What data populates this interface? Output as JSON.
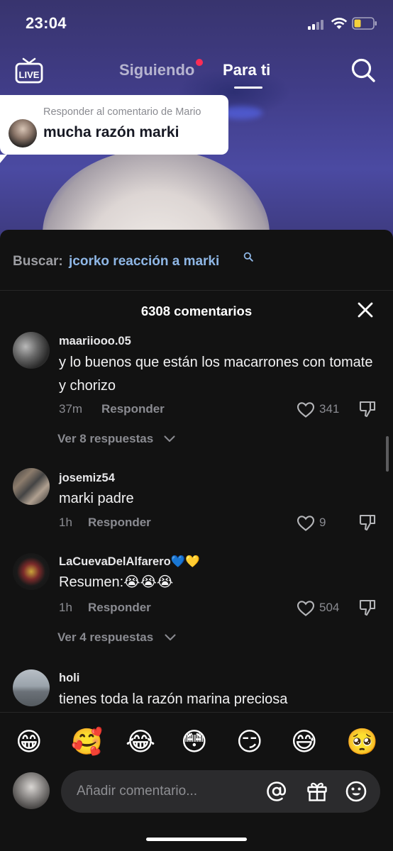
{
  "status_bar": {
    "time": "23:04",
    "icons": [
      "signal-icon",
      "wifi-icon",
      "battery-icon"
    ],
    "battery_color": "#f5d13b"
  },
  "top_nav": {
    "live_label": "LIVE",
    "tab_following": "Siguiendo",
    "tab_for_you": "Para ti",
    "active_tab": "Para ti",
    "notification_dot_color": "#fe2c55"
  },
  "reply_bubble": {
    "caption": "Responder al comentario de Mario",
    "text": "mucha razón marki"
  },
  "search": {
    "prefix": "Buscar:",
    "query": "jcorko reacción a marki"
  },
  "comments_header": {
    "count_label": "6308 comentarios"
  },
  "comments": [
    {
      "username": "maariiooo.05",
      "text": "y lo buenos que están los macarrones con tomate y chorizo",
      "time": "37m",
      "reply_label": "Responder",
      "likes": "341",
      "view_replies": "Ver 8 respuestas"
    },
    {
      "username": "josemiz54",
      "text": "marki padre",
      "time": "1h",
      "reply_label": "Responder",
      "likes": "9"
    },
    {
      "username": "LaCuevaDelAlfarero💙💛",
      "text": "Resumen:😭😭😭",
      "time": "1h",
      "reply_label": "Responder",
      "likes": "504",
      "view_replies": "Ver 4 respuestas"
    },
    {
      "username": "holi",
      "text": "tienes toda la razón marina preciosa"
    }
  ],
  "emoji_bar": [
    "😁",
    "🥰",
    "😂",
    "😳",
    "😏",
    "😅",
    "🥺"
  ],
  "comment_input": {
    "placeholder": "Añadir comentario..."
  },
  "colors": {
    "sheet_bg": "#121212",
    "search_query": "#8fb7e6",
    "accent_red": "#fe2c55"
  }
}
